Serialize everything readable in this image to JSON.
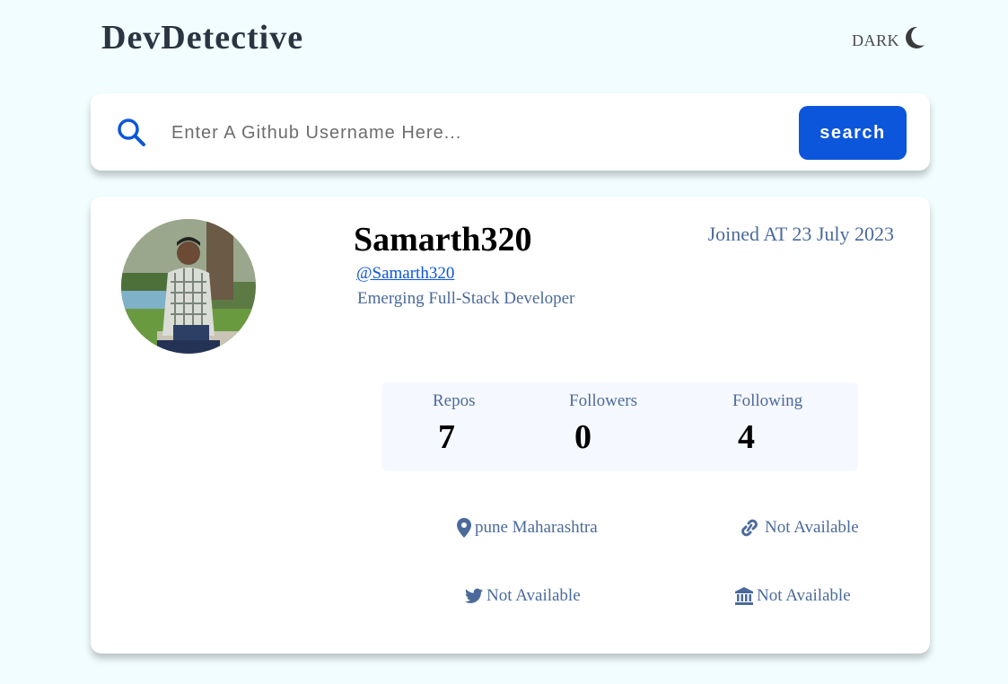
{
  "header": {
    "brand": "DevDetective",
    "theme_toggle_label": "DARK",
    "theme_icon": "moon-icon"
  },
  "search": {
    "icon": "search-icon",
    "placeholder": "Enter A Github Username Here...",
    "value": "",
    "button_label": "search"
  },
  "profile": {
    "avatar_alt": "Samarth320",
    "name": "Samarth320",
    "joined": "Joined AT 23 July 2023",
    "username": "@Samarth320",
    "bio": "Emerging Full-Stack Developer",
    "stats": [
      {
        "label": "Repos",
        "value": "7"
      },
      {
        "label": "Followers",
        "value": "0"
      },
      {
        "label": "Following",
        "value": "4"
      }
    ],
    "location": {
      "icon": "location-pin-icon",
      "text": "pune Maharashtra"
    },
    "website": {
      "icon": "link-icon",
      "text": "Not Available"
    },
    "twitter": {
      "icon": "twitter-icon",
      "text": "Not Available"
    },
    "company": {
      "icon": "building-icon",
      "text": "Not Available"
    }
  },
  "colors": {
    "background": "#f1fdfe",
    "accent": "#0c56dc",
    "muted_text": "#4b6a9b",
    "stats_bg": "#f6f8ff"
  }
}
